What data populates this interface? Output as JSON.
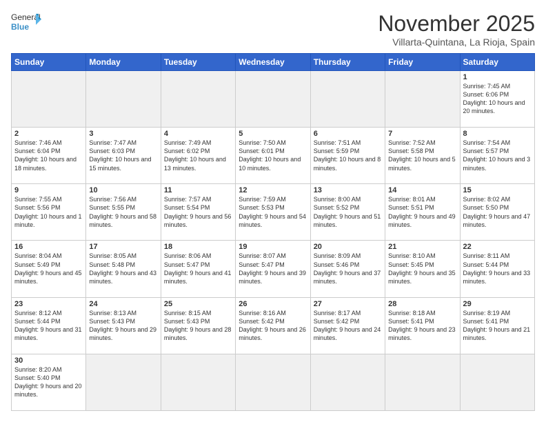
{
  "logo": {
    "text_general": "General",
    "text_blue": "Blue"
  },
  "title": "November 2025",
  "location": "Villarta-Quintana, La Rioja, Spain",
  "weekdays": [
    "Sunday",
    "Monday",
    "Tuesday",
    "Wednesday",
    "Thursday",
    "Friday",
    "Saturday"
  ],
  "weeks": [
    [
      {
        "day": "",
        "info": ""
      },
      {
        "day": "",
        "info": ""
      },
      {
        "day": "",
        "info": ""
      },
      {
        "day": "",
        "info": ""
      },
      {
        "day": "",
        "info": ""
      },
      {
        "day": "",
        "info": ""
      },
      {
        "day": "1",
        "info": "Sunrise: 7:45 AM\nSunset: 6:06 PM\nDaylight: 10 hours and 20 minutes."
      }
    ],
    [
      {
        "day": "2",
        "info": "Sunrise: 7:46 AM\nSunset: 6:04 PM\nDaylight: 10 hours and 18 minutes."
      },
      {
        "day": "3",
        "info": "Sunrise: 7:47 AM\nSunset: 6:03 PM\nDaylight: 10 hours and 15 minutes."
      },
      {
        "day": "4",
        "info": "Sunrise: 7:49 AM\nSunset: 6:02 PM\nDaylight: 10 hours and 13 minutes."
      },
      {
        "day": "5",
        "info": "Sunrise: 7:50 AM\nSunset: 6:01 PM\nDaylight: 10 hours and 10 minutes."
      },
      {
        "day": "6",
        "info": "Sunrise: 7:51 AM\nSunset: 5:59 PM\nDaylight: 10 hours and 8 minutes."
      },
      {
        "day": "7",
        "info": "Sunrise: 7:52 AM\nSunset: 5:58 PM\nDaylight: 10 hours and 5 minutes."
      },
      {
        "day": "8",
        "info": "Sunrise: 7:54 AM\nSunset: 5:57 PM\nDaylight: 10 hours and 3 minutes."
      }
    ],
    [
      {
        "day": "9",
        "info": "Sunrise: 7:55 AM\nSunset: 5:56 PM\nDaylight: 10 hours and 1 minute."
      },
      {
        "day": "10",
        "info": "Sunrise: 7:56 AM\nSunset: 5:55 PM\nDaylight: 9 hours and 58 minutes."
      },
      {
        "day": "11",
        "info": "Sunrise: 7:57 AM\nSunset: 5:54 PM\nDaylight: 9 hours and 56 minutes."
      },
      {
        "day": "12",
        "info": "Sunrise: 7:59 AM\nSunset: 5:53 PM\nDaylight: 9 hours and 54 minutes."
      },
      {
        "day": "13",
        "info": "Sunrise: 8:00 AM\nSunset: 5:52 PM\nDaylight: 9 hours and 51 minutes."
      },
      {
        "day": "14",
        "info": "Sunrise: 8:01 AM\nSunset: 5:51 PM\nDaylight: 9 hours and 49 minutes."
      },
      {
        "day": "15",
        "info": "Sunrise: 8:02 AM\nSunset: 5:50 PM\nDaylight: 9 hours and 47 minutes."
      }
    ],
    [
      {
        "day": "16",
        "info": "Sunrise: 8:04 AM\nSunset: 5:49 PM\nDaylight: 9 hours and 45 minutes."
      },
      {
        "day": "17",
        "info": "Sunrise: 8:05 AM\nSunset: 5:48 PM\nDaylight: 9 hours and 43 minutes."
      },
      {
        "day": "18",
        "info": "Sunrise: 8:06 AM\nSunset: 5:47 PM\nDaylight: 9 hours and 41 minutes."
      },
      {
        "day": "19",
        "info": "Sunrise: 8:07 AM\nSunset: 5:47 PM\nDaylight: 9 hours and 39 minutes."
      },
      {
        "day": "20",
        "info": "Sunrise: 8:09 AM\nSunset: 5:46 PM\nDaylight: 9 hours and 37 minutes."
      },
      {
        "day": "21",
        "info": "Sunrise: 8:10 AM\nSunset: 5:45 PM\nDaylight: 9 hours and 35 minutes."
      },
      {
        "day": "22",
        "info": "Sunrise: 8:11 AM\nSunset: 5:44 PM\nDaylight: 9 hours and 33 minutes."
      }
    ],
    [
      {
        "day": "23",
        "info": "Sunrise: 8:12 AM\nSunset: 5:44 PM\nDaylight: 9 hours and 31 minutes."
      },
      {
        "day": "24",
        "info": "Sunrise: 8:13 AM\nSunset: 5:43 PM\nDaylight: 9 hours and 29 minutes."
      },
      {
        "day": "25",
        "info": "Sunrise: 8:15 AM\nSunset: 5:43 PM\nDaylight: 9 hours and 28 minutes."
      },
      {
        "day": "26",
        "info": "Sunrise: 8:16 AM\nSunset: 5:42 PM\nDaylight: 9 hours and 26 minutes."
      },
      {
        "day": "27",
        "info": "Sunrise: 8:17 AM\nSunset: 5:42 PM\nDaylight: 9 hours and 24 minutes."
      },
      {
        "day": "28",
        "info": "Sunrise: 8:18 AM\nSunset: 5:41 PM\nDaylight: 9 hours and 23 minutes."
      },
      {
        "day": "29",
        "info": "Sunrise: 8:19 AM\nSunset: 5:41 PM\nDaylight: 9 hours and 21 minutes."
      }
    ],
    [
      {
        "day": "30",
        "info": "Sunrise: 8:20 AM\nSunset: 5:40 PM\nDaylight: 9 hours and 20 minutes."
      },
      {
        "day": "",
        "info": ""
      },
      {
        "day": "",
        "info": ""
      },
      {
        "day": "",
        "info": ""
      },
      {
        "day": "",
        "info": ""
      },
      {
        "day": "",
        "info": ""
      },
      {
        "day": "",
        "info": ""
      }
    ]
  ]
}
